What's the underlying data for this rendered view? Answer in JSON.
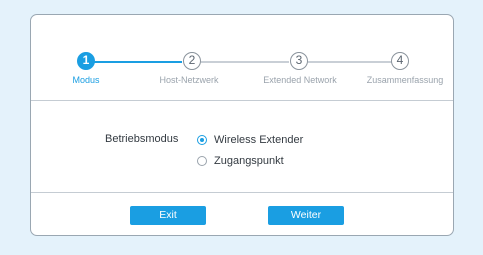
{
  "colors": {
    "accent": "#1a9ee2",
    "page_background": "#e4f2fb",
    "inactive": "#9aa3ac"
  },
  "stepper": {
    "current_step": 1,
    "steps": [
      {
        "number": "1",
        "label": "Modus",
        "state": "active"
      },
      {
        "number": "2",
        "label": "Host-Netzwerk",
        "state": "pending"
      },
      {
        "number": "3",
        "label": "Extended Network",
        "state": "pending"
      },
      {
        "number": "4",
        "label": "Zusammenfassung",
        "state": "pending"
      }
    ]
  },
  "mode": {
    "label": "Betriebsmodus",
    "options": [
      {
        "label": "Wireless Extender",
        "selected": true
      },
      {
        "label": "Zugangspunkt",
        "selected": false
      }
    ]
  },
  "buttons": {
    "exit_label": "Exit",
    "next_label": "Weiter"
  }
}
